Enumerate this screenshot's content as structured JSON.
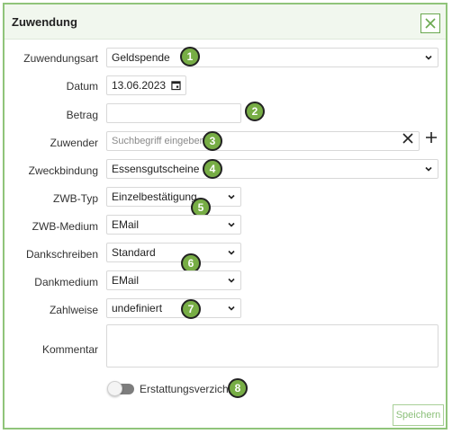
{
  "dialog": {
    "title": "Zuwendung",
    "save_label": "Speichern"
  },
  "fields": {
    "zuwendungsart": {
      "label": "Zuwendungsart",
      "value": "Geldspende"
    },
    "datum": {
      "label": "Datum",
      "value": "13.06.2023"
    },
    "betrag": {
      "label": "Betrag",
      "value": ""
    },
    "zuwender": {
      "label": "Zuwender",
      "placeholder": "Suchbegriff eingeben"
    },
    "zweckbindung": {
      "label": "Zweckbindung",
      "value": "Essensgutscheine"
    },
    "zwb_typ": {
      "label": "ZWB-Typ",
      "value": "Einzelbestätigung"
    },
    "zwb_medium": {
      "label": "ZWB-Medium",
      "value": "EMail"
    },
    "dankschreiben": {
      "label": "Dankschreiben",
      "value": "Standard"
    },
    "dankmedium": {
      "label": "Dankmedium",
      "value": "EMail"
    },
    "zahlweise": {
      "label": "Zahlweise",
      "value": "undefiniert"
    },
    "kommentar": {
      "label": "Kommentar",
      "value": ""
    },
    "erstattungsverzicht": {
      "label": "Erstattungsverzicht",
      "checked": false
    }
  },
  "badges": [
    "1",
    "2",
    "3",
    "4",
    "5",
    "6",
    "7",
    "8"
  ],
  "colors": {
    "accent": "#77ad45",
    "border": "#90c47a",
    "header_bg": "#f1f7ee"
  },
  "icons": {
    "close": "close-icon",
    "calendar": "calendar-icon",
    "chevron": "chevron-down-icon",
    "clear": "clear-icon",
    "add": "plus-icon"
  }
}
